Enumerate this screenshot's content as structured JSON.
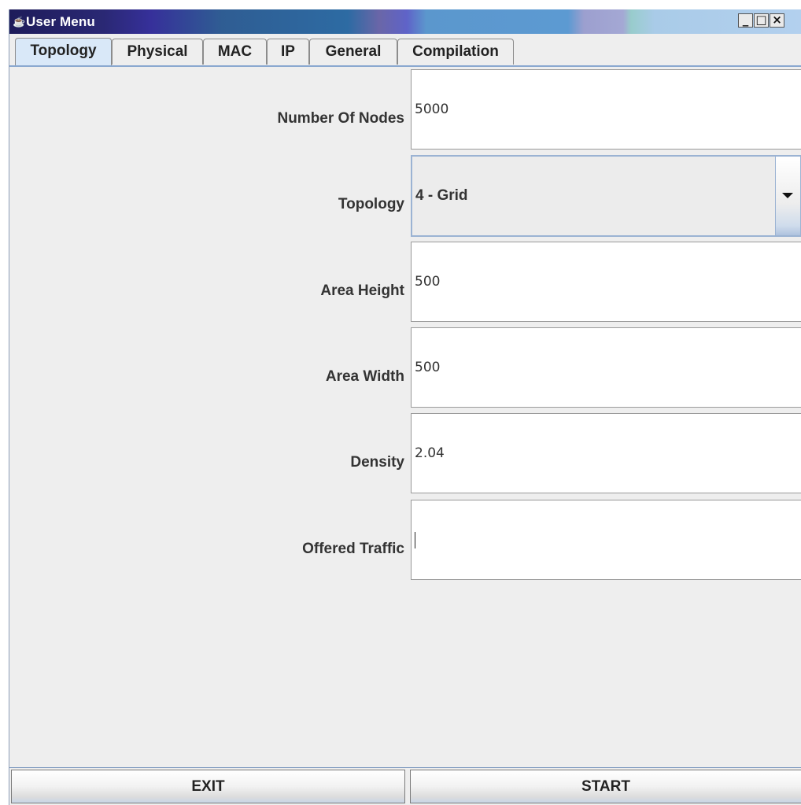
{
  "window": {
    "title": "User Menu",
    "icon": "java-cup-icon",
    "controls": {
      "minimize": "_",
      "maximize": "□",
      "close": "×"
    }
  },
  "tabs": [
    {
      "label": "Topology",
      "active": true
    },
    {
      "label": "Physical",
      "active": false
    },
    {
      "label": "MAC",
      "active": false
    },
    {
      "label": "IP",
      "active": false
    },
    {
      "label": "General",
      "active": false
    },
    {
      "label": "Compilation",
      "active": false
    }
  ],
  "form": {
    "number_of_nodes": {
      "label": "Number Of Nodes",
      "value": "5000"
    },
    "topology": {
      "label": "Topology",
      "value": "4 - Grid"
    },
    "area_height": {
      "label": "Area Height",
      "value": "500"
    },
    "area_width": {
      "label": "Area Width",
      "value": "500"
    },
    "density": {
      "label": "Density",
      "value": "2.04"
    },
    "offered_traffic": {
      "label": "Offered Traffic",
      "value": ""
    }
  },
  "buttons": {
    "exit": "EXIT",
    "start": "START"
  },
  "colors": {
    "titlebar_start": "#1e1c5a",
    "tab_active": "#d9e8f8",
    "window_bg": "#eeeeee"
  }
}
